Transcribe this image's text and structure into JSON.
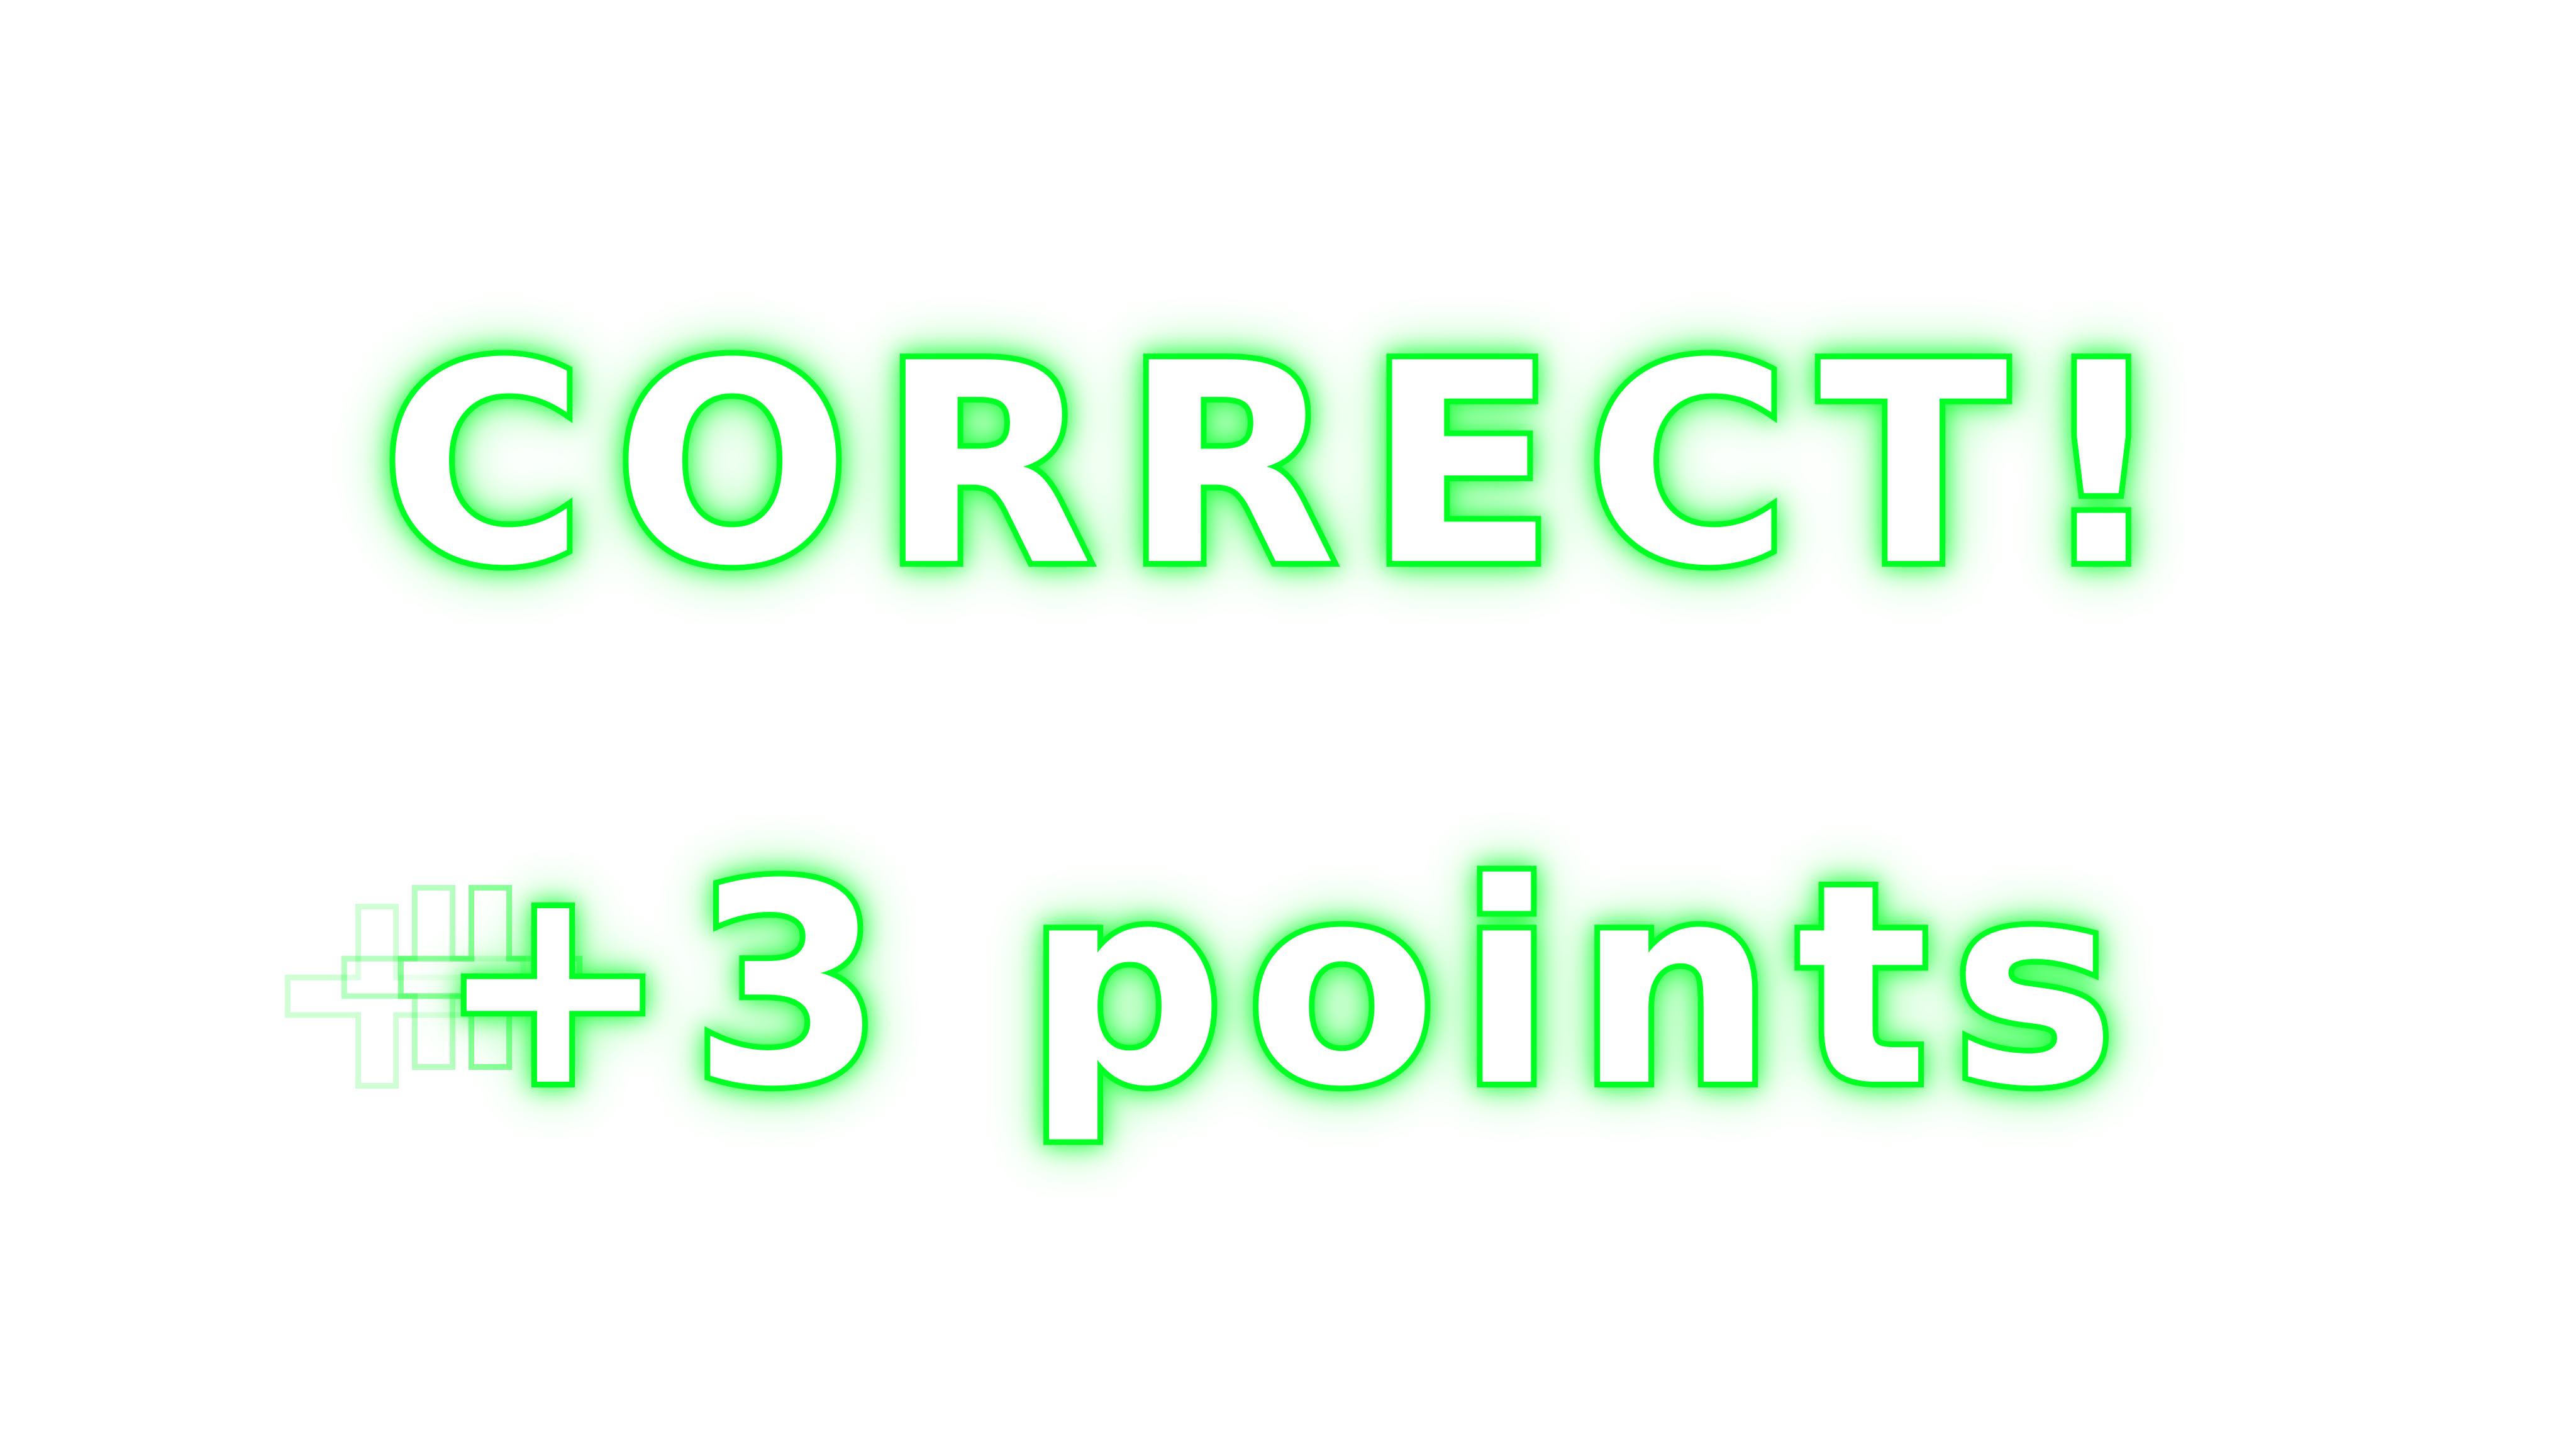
{
  "feedback": {
    "result_label": "CORRECT!",
    "points_label": "+3 points",
    "ghost_glyph": "+"
  },
  "colors": {
    "background": "#ffffff",
    "text_fill": "#ffffff",
    "outline_glow": "#00ff22"
  }
}
